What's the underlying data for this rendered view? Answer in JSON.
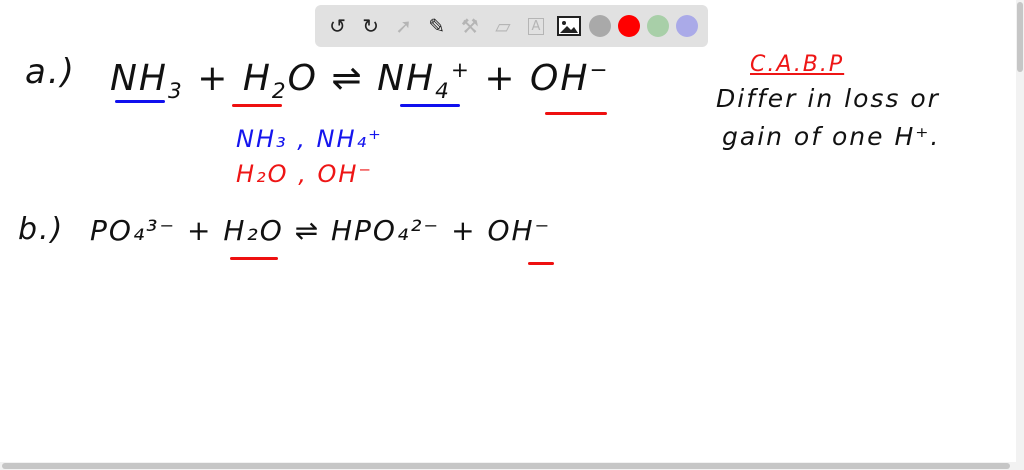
{
  "toolbar": {
    "tools": [
      "undo-icon",
      "redo-icon",
      "select-icon",
      "pen-icon",
      "tools-icon",
      "eraser-icon",
      "text-icon",
      "image-icon"
    ],
    "colors": [
      "#a9a9a9",
      "#ff0000",
      "#a8cfa8",
      "#aaaae8"
    ]
  },
  "board": {
    "a_label": "a.)",
    "a_eq": {
      "r1": "NH",
      "r1s": "3",
      "plus1": "+",
      "r2": "H",
      "r2s": "2",
      "r2b": "O",
      "arrow": "⇌",
      "p1": "NH",
      "p1s": "4",
      "p1c": "+",
      "plus2": "+",
      "p2": "OH",
      "p2c": "−"
    },
    "pair_blue": "NH₃ , NH₄⁺",
    "pair_red": "H₂O , OH⁻",
    "b_label": "b.)",
    "b_eq": "PO₄³⁻ + H₂O ⇌ HPO₄²⁻ + OH⁻",
    "note_title": "C.A.B.P",
    "note_line1": "Differ in loss or",
    "note_line2": "gain of one H⁺."
  }
}
